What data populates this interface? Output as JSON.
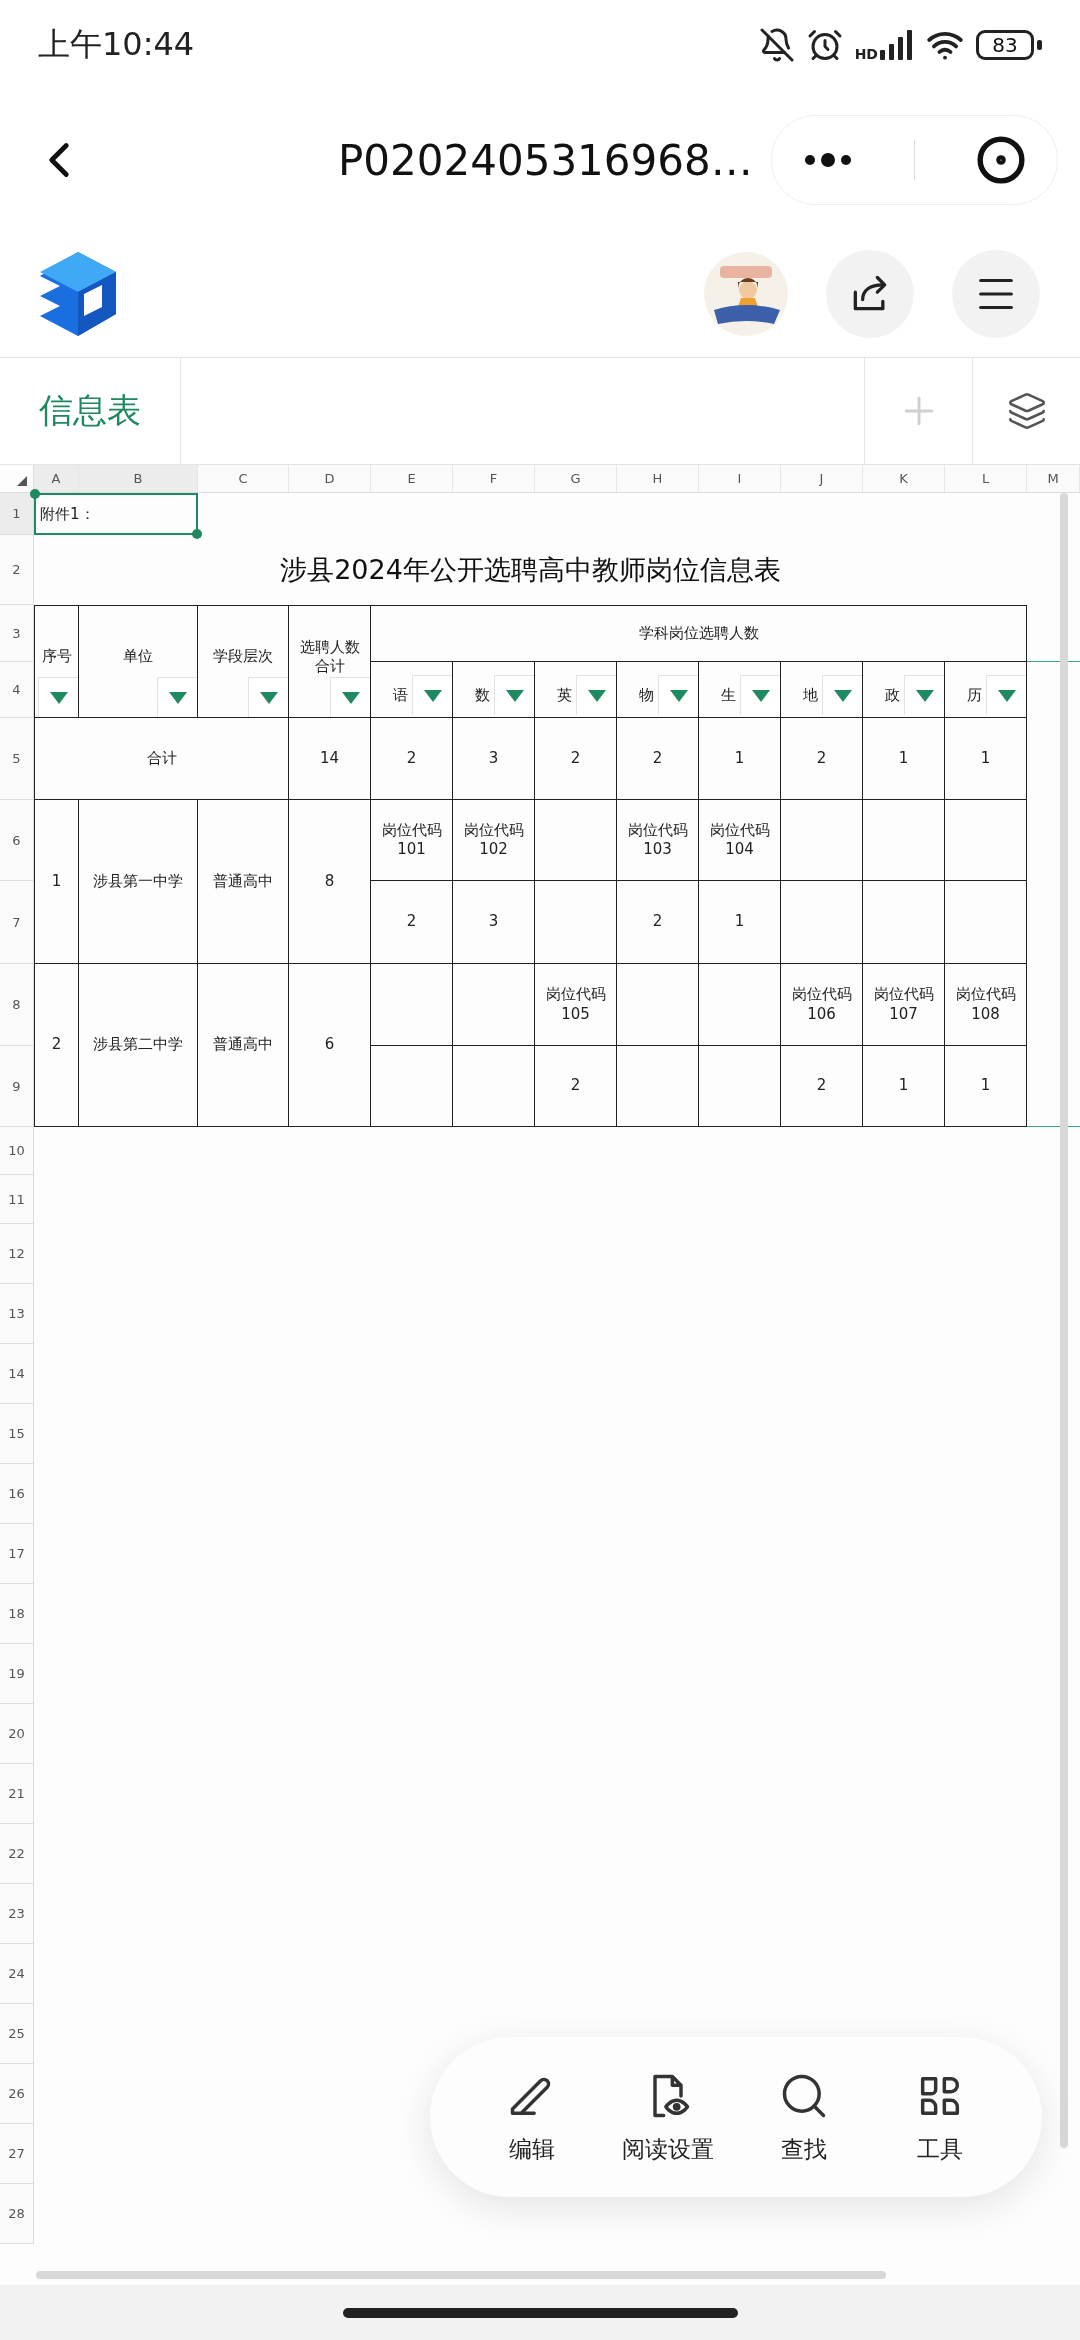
{
  "status_bar": {
    "time": "上午10:44",
    "network": "HD",
    "battery": "83"
  },
  "nav": {
    "title": "P0202405316968…"
  },
  "sheet_tabs": [
    {
      "label": "信息表",
      "selected": true
    }
  ],
  "add_sheet": {
    "disabled": true
  },
  "columns": [
    {
      "label": "A",
      "selected": true
    },
    {
      "label": "B",
      "selected": true
    },
    {
      "label": "C",
      "selected": false
    },
    {
      "label": "D",
      "selected": false
    },
    {
      "label": "E",
      "selected": false
    },
    {
      "label": "F",
      "selected": false
    },
    {
      "label": "G",
      "selected": false
    },
    {
      "label": "H",
      "selected": false
    },
    {
      "label": "I",
      "selected": false
    },
    {
      "label": "J",
      "selected": false
    },
    {
      "label": "K",
      "selected": false
    },
    {
      "label": "L",
      "selected": false
    },
    {
      "label": "M",
      "selected": false
    }
  ],
  "rows": [
    {
      "label": "1",
      "selected": true
    },
    {
      "label": "2",
      "selected": false
    },
    {
      "label": "3",
      "selected": false
    },
    {
      "label": "4",
      "selected": false
    },
    {
      "label": "5",
      "selected": false
    },
    {
      "label": "6",
      "selected": false
    },
    {
      "label": "7",
      "selected": false
    },
    {
      "label": "8",
      "selected": false
    },
    {
      "label": "9",
      "selected": false
    },
    {
      "label": "10",
      "selected": false
    },
    {
      "label": "11",
      "selected": false
    },
    {
      "label": "12",
      "selected": false
    },
    {
      "label": "13",
      "selected": false
    },
    {
      "label": "14",
      "selected": false
    },
    {
      "label": "15",
      "selected": false
    },
    {
      "label": "16",
      "selected": false
    },
    {
      "label": "17",
      "selected": false
    },
    {
      "label": "18",
      "selected": false
    },
    {
      "label": "19",
      "selected": false
    },
    {
      "label": "20",
      "selected": false
    },
    {
      "label": "21",
      "selected": false
    },
    {
      "label": "22",
      "selected": false
    },
    {
      "label": "23",
      "selected": false
    },
    {
      "label": "24",
      "selected": false
    },
    {
      "label": "25",
      "selected": false
    },
    {
      "label": "26",
      "selected": false
    },
    {
      "label": "27",
      "selected": false
    },
    {
      "label": "28",
      "selected": false
    }
  ],
  "note": {
    "text": "附件1：",
    "selected": true
  },
  "title": "涉县2024年公开选聘高中教师岗位信息表",
  "table": {
    "header": {
      "columns": [
        "序号",
        "单位",
        "学段层次",
        "选聘人数合计"
      ],
      "group": "学科岗位选聘人数",
      "subjects": [
        "语",
        "数",
        "英",
        "物",
        "生",
        "地",
        "政",
        "历"
      ]
    },
    "total": {
      "label": "合计",
      "count": "14",
      "values": [
        "2",
        "3",
        "2",
        "2",
        "1",
        "2",
        "1",
        "1"
      ]
    },
    "schools": [
      {
        "number": "1",
        "name": "涉县第一中学",
        "level": "普通高中",
        "count": "8",
        "posts": [
          {
            "kind": "post",
            "code": "岗位代码 101",
            "count": "2"
          },
          {
            "kind": "post",
            "code": "岗位代码 102",
            "count": "3"
          },
          {
            "kind": "empty"
          },
          {
            "kind": "post",
            "code": "岗位代码 103",
            "count": "2"
          },
          {
            "kind": "post",
            "code": "岗位代码 104",
            "count": "1"
          },
          {
            "kind": "empty"
          },
          {
            "kind": "empty"
          },
          {
            "kind": "empty"
          }
        ]
      },
      {
        "number": "2",
        "name": "涉县第二中学",
        "level": "普通高中",
        "count": "6",
        "posts": [
          {
            "kind": "empty"
          },
          {
            "kind": "empty"
          },
          {
            "kind": "post",
            "code": "岗位代码 105",
            "count": "2"
          },
          {
            "kind": "empty"
          },
          {
            "kind": "empty"
          },
          {
            "kind": "post",
            "code": "岗位代码 106",
            "count": "2"
          },
          {
            "kind": "post",
            "code": "岗位代码 107",
            "count": "1"
          },
          {
            "kind": "post",
            "code": "岗位代码 108",
            "count": "1"
          }
        ]
      }
    ]
  },
  "toolbar": [
    {
      "kind": "edit",
      "label": "编辑"
    },
    {
      "kind": "read",
      "label": "阅读设置"
    },
    {
      "kind": "search",
      "label": "查找"
    },
    {
      "kind": "tools",
      "label": "工具"
    }
  ]
}
